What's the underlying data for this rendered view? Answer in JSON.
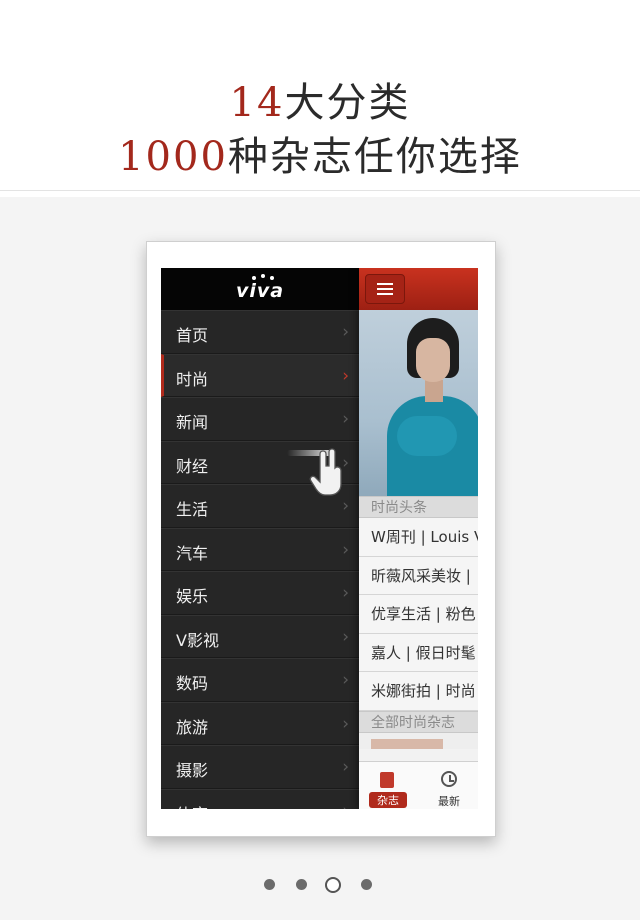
{
  "headline": {
    "line1_num": "14",
    "line1_text": "大分类",
    "line2_num": "1000",
    "line2_text": "种杂志任你选择"
  },
  "colors": {
    "accent": "#a3281c",
    "menu_bg": "#262626",
    "topbar": "#b02a1c"
  },
  "app": {
    "logo": "viva",
    "menu_items": [
      {
        "label": "首页"
      },
      {
        "label": "时尚",
        "active": true
      },
      {
        "label": "新闻"
      },
      {
        "label": "财经"
      },
      {
        "label": "生活"
      },
      {
        "label": "汽车"
      },
      {
        "label": "娱乐"
      },
      {
        "label": "V影视"
      },
      {
        "label": "数码"
      },
      {
        "label": "旅游"
      },
      {
        "label": "摄影"
      },
      {
        "label": "体育"
      }
    ],
    "chevron": "›",
    "content": {
      "section_headlines": "时尚头条",
      "news": [
        "W周刊 | Louis V",
        "昕薇风采美妆 |",
        "优享生活 | 粉色",
        "嘉人 | 假日时髦",
        "米娜街拍 | 时尚"
      ],
      "section_all": "全部时尚杂志"
    },
    "tabs": [
      {
        "label": "杂志",
        "icon": "magazine-icon",
        "selected": true
      },
      {
        "label": "最新",
        "icon": "clock-icon"
      }
    ]
  },
  "pager": {
    "count": 4,
    "current": 3
  }
}
